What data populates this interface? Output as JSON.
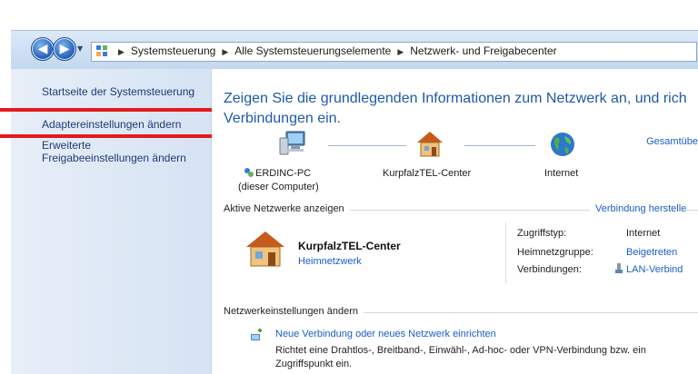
{
  "breadcrumb": [
    "Systemsteuerung",
    "Alle Systemsteuerungselemente",
    "Netzwerk- und Freigabecenter"
  ],
  "sidebar": {
    "home": "Startseite der Systemsteuerung",
    "adapter": "Adaptereinstellungen ändern",
    "advanced_line1": "Erweiterte",
    "advanced_line2": "Freigabeeinstellungen ändern"
  },
  "main": {
    "heading_line1": "Zeigen Sie die grundlegenden Informationen zum Netzwerk an, und rich",
    "heading_line2": "Verbindungen ein.",
    "full_map": "Gesamtübe",
    "nodes": {
      "computer_name": "ERDINC-PC",
      "computer_sub": "(dieser Computer)",
      "network": "KurpfalzTEL-Center",
      "internet": "Internet"
    },
    "active_networks": {
      "title": "Aktive Netzwerke anzeigen",
      "connect_link": "Verbindung herstelle",
      "name": "KurpfalzTEL-Center",
      "type": "Heimnetzwerk",
      "props": {
        "access_label": "Zugriffstyp:",
        "access_value": "Internet",
        "homegroup_label": "Heimnetzgruppe:",
        "homegroup_value": "Beigetreten",
        "connections_label": "Verbindungen:",
        "connections_value": "LAN-Verbind"
      }
    },
    "change_settings": {
      "title": "Netzwerkeinstellungen ändern",
      "task1_title": "Neue Verbindung oder neues Netzwerk einrichten",
      "task1_desc_line1": "Richtet eine Drahtlos-, Breitband-, Einwähl-, Ad-hoc- oder VPN-Verbindung bzw. ein",
      "task1_desc_line2": "Zugriffspunkt ein."
    }
  }
}
